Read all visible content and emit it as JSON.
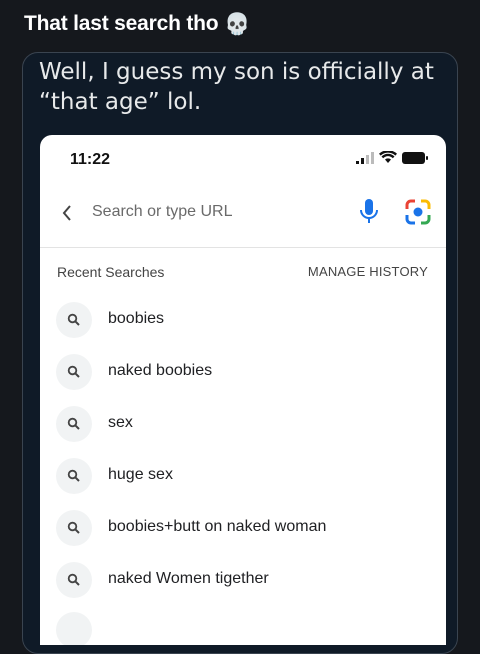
{
  "caption": {
    "text": "That last search tho",
    "emoji": "💀"
  },
  "tweet": {
    "text": "Well, I guess my son is officially at “that age” lol."
  },
  "phone": {
    "status_time": "11:22",
    "url_placeholder": "Search or type URL",
    "recent_header": "Recent Searches",
    "manage_history": "MANAGE HISTORY",
    "recent_searches": [
      "boobies",
      "naked boobies",
      "sex",
      "huge sex",
      "boobies+butt on naked woman",
      "naked Women tigether"
    ]
  },
  "colors": {
    "background": "#15181d",
    "card": "#0f1a27",
    "mic_blue": "#1a73e8",
    "lens_red": "#ea4335",
    "lens_yellow": "#fbbc04",
    "lens_green": "#34a853"
  }
}
